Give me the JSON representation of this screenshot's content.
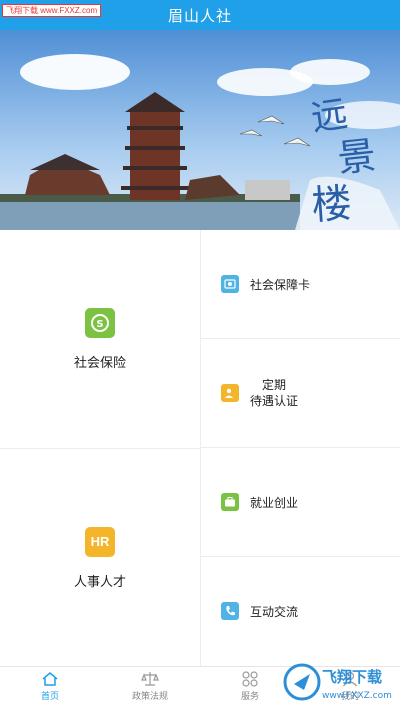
{
  "header": {
    "title": "眉山人社",
    "watermark": "飞翔下载 www.FXXZ.com"
  },
  "banner": {
    "calligraphy": [
      "远",
      "景",
      "楼"
    ]
  },
  "grid": {
    "social_insurance": "社会保险",
    "hr_talent": "人事人才",
    "hr_badge": "HR",
    "social_card": "社会保障卡",
    "regular_line1": "定期",
    "regular_line2": "待遇认证",
    "employment": "就业创业",
    "interaction": "互动交流"
  },
  "tabs": [
    {
      "label": "首页"
    },
    {
      "label": "政策法规"
    },
    {
      "label": "服务"
    },
    {
      "label": "我的"
    }
  ],
  "watermark_bottom": {
    "brand": "飞翔下载",
    "url": "www.FXXZ.com"
  },
  "colors": {
    "accent": "#1fa0e8",
    "green": "#7cc242",
    "gold": "#f4b52a",
    "sky": "#4fb3e6"
  }
}
